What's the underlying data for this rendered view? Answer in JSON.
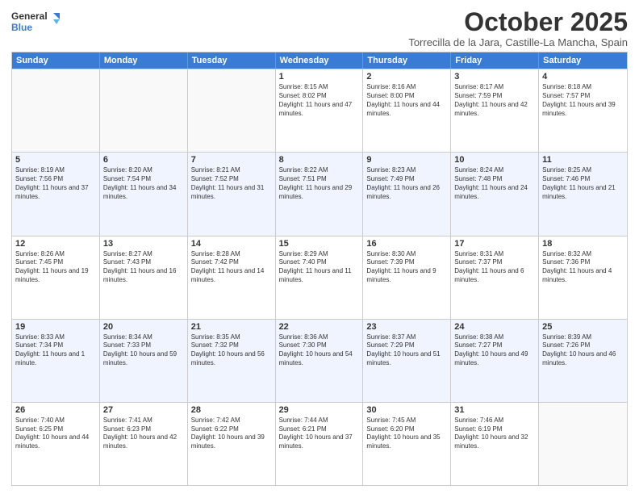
{
  "logo": {
    "line1": "General",
    "line2": "Blue"
  },
  "title": "October 2025",
  "subtitle": "Torrecilla de la Jara, Castille-La Mancha, Spain",
  "headers": [
    "Sunday",
    "Monday",
    "Tuesday",
    "Wednesday",
    "Thursday",
    "Friday",
    "Saturday"
  ],
  "rows": [
    {
      "alt": false,
      "cells": [
        {
          "day": "",
          "sun": "",
          "set": "",
          "day_text": "",
          "empty": true
        },
        {
          "day": "",
          "sun": "",
          "set": "",
          "day_text": "",
          "empty": true
        },
        {
          "day": "",
          "sun": "",
          "set": "",
          "day_text": "",
          "empty": true
        },
        {
          "day": "1",
          "sun": "Sunrise: 8:15 AM",
          "set": "Sunset: 8:02 PM",
          "day_text": "Daylight: 11 hours and 47 minutes.",
          "empty": false
        },
        {
          "day": "2",
          "sun": "Sunrise: 8:16 AM",
          "set": "Sunset: 8:00 PM",
          "day_text": "Daylight: 11 hours and 44 minutes.",
          "empty": false
        },
        {
          "day": "3",
          "sun": "Sunrise: 8:17 AM",
          "set": "Sunset: 7:59 PM",
          "day_text": "Daylight: 11 hours and 42 minutes.",
          "empty": false
        },
        {
          "day": "4",
          "sun": "Sunrise: 8:18 AM",
          "set": "Sunset: 7:57 PM",
          "day_text": "Daylight: 11 hours and 39 minutes.",
          "empty": false
        }
      ]
    },
    {
      "alt": true,
      "cells": [
        {
          "day": "5",
          "sun": "Sunrise: 8:19 AM",
          "set": "Sunset: 7:56 PM",
          "day_text": "Daylight: 11 hours and 37 minutes.",
          "empty": false
        },
        {
          "day": "6",
          "sun": "Sunrise: 8:20 AM",
          "set": "Sunset: 7:54 PM",
          "day_text": "Daylight: 11 hours and 34 minutes.",
          "empty": false
        },
        {
          "day": "7",
          "sun": "Sunrise: 8:21 AM",
          "set": "Sunset: 7:52 PM",
          "day_text": "Daylight: 11 hours and 31 minutes.",
          "empty": false
        },
        {
          "day": "8",
          "sun": "Sunrise: 8:22 AM",
          "set": "Sunset: 7:51 PM",
          "day_text": "Daylight: 11 hours and 29 minutes.",
          "empty": false
        },
        {
          "day": "9",
          "sun": "Sunrise: 8:23 AM",
          "set": "Sunset: 7:49 PM",
          "day_text": "Daylight: 11 hours and 26 minutes.",
          "empty": false
        },
        {
          "day": "10",
          "sun": "Sunrise: 8:24 AM",
          "set": "Sunset: 7:48 PM",
          "day_text": "Daylight: 11 hours and 24 minutes.",
          "empty": false
        },
        {
          "day": "11",
          "sun": "Sunrise: 8:25 AM",
          "set": "Sunset: 7:46 PM",
          "day_text": "Daylight: 11 hours and 21 minutes.",
          "empty": false
        }
      ]
    },
    {
      "alt": false,
      "cells": [
        {
          "day": "12",
          "sun": "Sunrise: 8:26 AM",
          "set": "Sunset: 7:45 PM",
          "day_text": "Daylight: 11 hours and 19 minutes.",
          "empty": false
        },
        {
          "day": "13",
          "sun": "Sunrise: 8:27 AM",
          "set": "Sunset: 7:43 PM",
          "day_text": "Daylight: 11 hours and 16 minutes.",
          "empty": false
        },
        {
          "day": "14",
          "sun": "Sunrise: 8:28 AM",
          "set": "Sunset: 7:42 PM",
          "day_text": "Daylight: 11 hours and 14 minutes.",
          "empty": false
        },
        {
          "day": "15",
          "sun": "Sunrise: 8:29 AM",
          "set": "Sunset: 7:40 PM",
          "day_text": "Daylight: 11 hours and 11 minutes.",
          "empty": false
        },
        {
          "day": "16",
          "sun": "Sunrise: 8:30 AM",
          "set": "Sunset: 7:39 PM",
          "day_text": "Daylight: 11 hours and 9 minutes.",
          "empty": false
        },
        {
          "day": "17",
          "sun": "Sunrise: 8:31 AM",
          "set": "Sunset: 7:37 PM",
          "day_text": "Daylight: 11 hours and 6 minutes.",
          "empty": false
        },
        {
          "day": "18",
          "sun": "Sunrise: 8:32 AM",
          "set": "Sunset: 7:36 PM",
          "day_text": "Daylight: 11 hours and 4 minutes.",
          "empty": false
        }
      ]
    },
    {
      "alt": true,
      "cells": [
        {
          "day": "19",
          "sun": "Sunrise: 8:33 AM",
          "set": "Sunset: 7:34 PM",
          "day_text": "Daylight: 11 hours and 1 minute.",
          "empty": false
        },
        {
          "day": "20",
          "sun": "Sunrise: 8:34 AM",
          "set": "Sunset: 7:33 PM",
          "day_text": "Daylight: 10 hours and 59 minutes.",
          "empty": false
        },
        {
          "day": "21",
          "sun": "Sunrise: 8:35 AM",
          "set": "Sunset: 7:32 PM",
          "day_text": "Daylight: 10 hours and 56 minutes.",
          "empty": false
        },
        {
          "day": "22",
          "sun": "Sunrise: 8:36 AM",
          "set": "Sunset: 7:30 PM",
          "day_text": "Daylight: 10 hours and 54 minutes.",
          "empty": false
        },
        {
          "day": "23",
          "sun": "Sunrise: 8:37 AM",
          "set": "Sunset: 7:29 PM",
          "day_text": "Daylight: 10 hours and 51 minutes.",
          "empty": false
        },
        {
          "day": "24",
          "sun": "Sunrise: 8:38 AM",
          "set": "Sunset: 7:27 PM",
          "day_text": "Daylight: 10 hours and 49 minutes.",
          "empty": false
        },
        {
          "day": "25",
          "sun": "Sunrise: 8:39 AM",
          "set": "Sunset: 7:26 PM",
          "day_text": "Daylight: 10 hours and 46 minutes.",
          "empty": false
        }
      ]
    },
    {
      "alt": false,
      "cells": [
        {
          "day": "26",
          "sun": "Sunrise: 7:40 AM",
          "set": "Sunset: 6:25 PM",
          "day_text": "Daylight: 10 hours and 44 minutes.",
          "empty": false
        },
        {
          "day": "27",
          "sun": "Sunrise: 7:41 AM",
          "set": "Sunset: 6:23 PM",
          "day_text": "Daylight: 10 hours and 42 minutes.",
          "empty": false
        },
        {
          "day": "28",
          "sun": "Sunrise: 7:42 AM",
          "set": "Sunset: 6:22 PM",
          "day_text": "Daylight: 10 hours and 39 minutes.",
          "empty": false
        },
        {
          "day": "29",
          "sun": "Sunrise: 7:44 AM",
          "set": "Sunset: 6:21 PM",
          "day_text": "Daylight: 10 hours and 37 minutes.",
          "empty": false
        },
        {
          "day": "30",
          "sun": "Sunrise: 7:45 AM",
          "set": "Sunset: 6:20 PM",
          "day_text": "Daylight: 10 hours and 35 minutes.",
          "empty": false
        },
        {
          "day": "31",
          "sun": "Sunrise: 7:46 AM",
          "set": "Sunset: 6:19 PM",
          "day_text": "Daylight: 10 hours and 32 minutes.",
          "empty": false
        },
        {
          "day": "",
          "sun": "",
          "set": "",
          "day_text": "",
          "empty": true
        }
      ]
    }
  ]
}
